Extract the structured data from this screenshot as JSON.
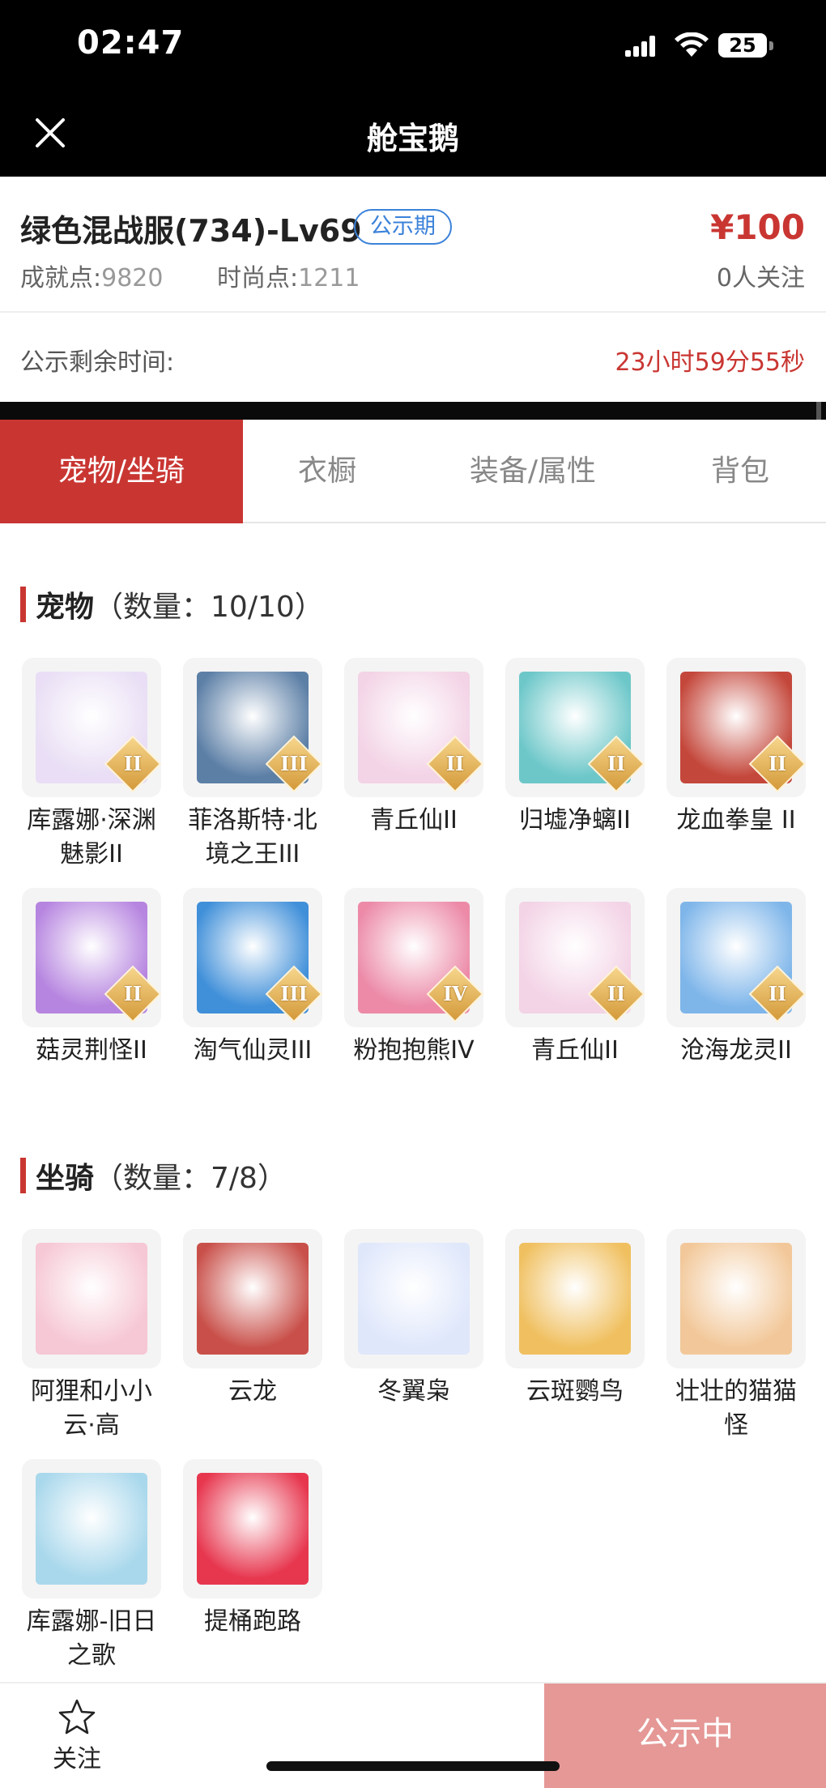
{
  "status_bar": {
    "time": "02:47",
    "battery": "25"
  },
  "nav": {
    "title": "舱宝鹅"
  },
  "listing": {
    "name": "绿色混战服(734)-Lv69",
    "badge": "公示期",
    "price": "¥100",
    "achievement_label": "成就点:",
    "achievement_value": "9820",
    "fashion_label": "时尚点:",
    "fashion_value": "1211",
    "followers": "0人关注"
  },
  "countdown": {
    "label": "公示剩余时间:",
    "value": "23小时59分55秒"
  },
  "tabs": [
    {
      "label": "宠物/坐骑",
      "active": true
    },
    {
      "label": "衣橱",
      "active": false
    },
    {
      "label": "装备/属性",
      "active": false
    },
    {
      "label": "背包",
      "active": false
    }
  ],
  "pets_section": {
    "title": "宠物",
    "count": "（数量：10/10）"
  },
  "pets": [
    {
      "name": "库露娜·深渊魅影II",
      "tier": "II",
      "color": "#e9def5"
    },
    {
      "name": "菲洛斯特·北境之王III",
      "tier": "III",
      "color": "#5c7fa6"
    },
    {
      "name": "青丘仙II",
      "tier": "II",
      "color": "#f3d3e6"
    },
    {
      "name": "归墟净螭II",
      "tier": "II",
      "color": "#6dc7c9"
    },
    {
      "name": "龙血拳皇 II",
      "tier": "II",
      "color": "#c4473b"
    },
    {
      "name": "菇灵荆怪II",
      "tier": "II",
      "color": "#b685e0"
    },
    {
      "name": "淘气仙灵III",
      "tier": "III",
      "color": "#3f8fd9"
    },
    {
      "name": "粉抱抱熊IV",
      "tier": "IV",
      "color": "#ec8aa8"
    },
    {
      "name": "青丘仙II",
      "tier": "II",
      "color": "#f3d3e6"
    },
    {
      "name": "沧海龙灵II",
      "tier": "II",
      "color": "#7fb6ea"
    }
  ],
  "mounts_section": {
    "title": "坐骑",
    "count": "（数量：7/8）"
  },
  "mounts": [
    {
      "name": "阿狸和小小云·高",
      "color": "#f6c7d4"
    },
    {
      "name": "云龙",
      "color": "#c9504a"
    },
    {
      "name": "冬翼枭",
      "color": "#dfe7fb"
    },
    {
      "name": "云斑鹦鸟",
      "color": "#f0c060"
    },
    {
      "name": "壮壮的猫猫怪",
      "color": "#f2c89a"
    },
    {
      "name": "库露娜-旧日之歌",
      "color": "#a9d8ec"
    },
    {
      "name": "提桶跑路",
      "color": "#e7374f"
    }
  ],
  "bottom": {
    "follow_label": "关注",
    "action_label": "公示中"
  }
}
